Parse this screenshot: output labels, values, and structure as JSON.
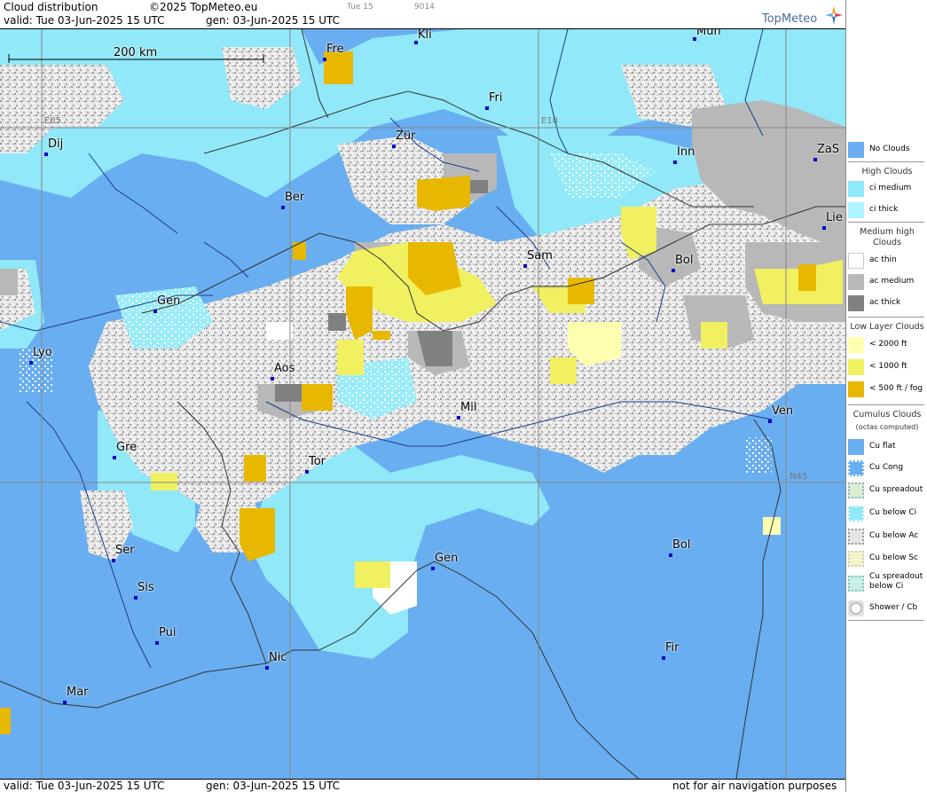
{
  "header": {
    "title": "Cloud distribution",
    "copyright": "©2025 TopMeteo.eu",
    "day_tag": "Tue 15",
    "code": "9014",
    "valid": "valid:  Tue  03-Jun-2025  15 UTC",
    "gen": "gen: 03-Jun-2025 15 UTC",
    "logo": "TopMeteo"
  },
  "map": {
    "scale_label": "200 km",
    "grid_labels": {
      "lon_e05": "E05",
      "lon_e10": "E10",
      "lat_n45": "N45"
    },
    "cities": [
      {
        "name": "Fre",
        "id": "freiburg"
      },
      {
        "name": "Kli",
        "id": "klippeneck"
      },
      {
        "name": "Mun",
        "id": "munich"
      },
      {
        "name": "Fri",
        "id": "friedrichshafen"
      },
      {
        "name": "Dij",
        "id": "dijon"
      },
      {
        "name": "Zür",
        "id": "zurich"
      },
      {
        "name": "Inn",
        "id": "innsbruck"
      },
      {
        "name": "ZaS",
        "id": "zell-am-see"
      },
      {
        "name": "Ber",
        "id": "bern"
      },
      {
        "name": "Lie",
        "id": "lienz"
      },
      {
        "name": "Sam",
        "id": "samedan"
      },
      {
        "name": "Bol",
        "id": "bolzano"
      },
      {
        "name": "Gen",
        "id": "geneva"
      },
      {
        "name": "Lyo",
        "id": "lyon"
      },
      {
        "name": "Aos",
        "id": "aosta"
      },
      {
        "name": "Mil",
        "id": "milan"
      },
      {
        "name": "Ven",
        "id": "venice"
      },
      {
        "name": "Gre",
        "id": "grenoble"
      },
      {
        "name": "Tor",
        "id": "turin"
      },
      {
        "name": "Gen",
        "id": "genoa"
      },
      {
        "name": "Bol",
        "id": "bologna"
      },
      {
        "name": "Ser",
        "id": "serres"
      },
      {
        "name": "Sis",
        "id": "sisteron"
      },
      {
        "name": "Pui",
        "id": "puimoisson"
      },
      {
        "name": "Nic",
        "id": "nice"
      },
      {
        "name": "Fir",
        "id": "florence"
      },
      {
        "name": "Mar",
        "id": "marseille"
      }
    ]
  },
  "footer": {
    "valid": "valid:  Tue  03-Jun-2025  15 UTC",
    "gen": "gen: 03-Jun-2025 15 UTC",
    "disclaimer": "not for air navigation purposes"
  },
  "legend": {
    "no_clouds": "No Clouds",
    "high_clouds": "High Clouds",
    "ci_medium": "ci medium",
    "ci_thick": "ci thick",
    "medium_high_clouds": "Medium high Clouds",
    "ac_thin": "ac thin",
    "ac_medium": "ac medium",
    "ac_thick": "ac thick",
    "low_layer_clouds": "Low Layer Clouds",
    "low_2000": "< 2000 ft",
    "low_1000": "< 1000 ft",
    "low_500": "< 500 ft / fog",
    "cumulus_clouds": "Cumulus Clouds",
    "octas": "(octas computed)",
    "cu_flat": "Cu flat",
    "cu_cong": "Cu Cong",
    "cu_spreadout": "Cu spreadout",
    "cu_below_ci": "Cu below Ci",
    "cu_below_ac": "Cu below Ac",
    "cu_below_sc": "Cu below Sc",
    "cu_spreadout_below_ci": "Cu spreadout below Ci",
    "shower_cb": "Shower / Cb"
  },
  "colors": {
    "no_clouds": "#69aef0",
    "ci_medium": "#90e8f8",
    "ci_thick": "#b0f4ff",
    "ac_thin": "#ffffff",
    "ac_medium": "#b8b8b8",
    "ac_thick": "#808080",
    "low_2000": "#ffffb0",
    "low_1000": "#f0f060",
    "low_500": "#e8b800"
  }
}
